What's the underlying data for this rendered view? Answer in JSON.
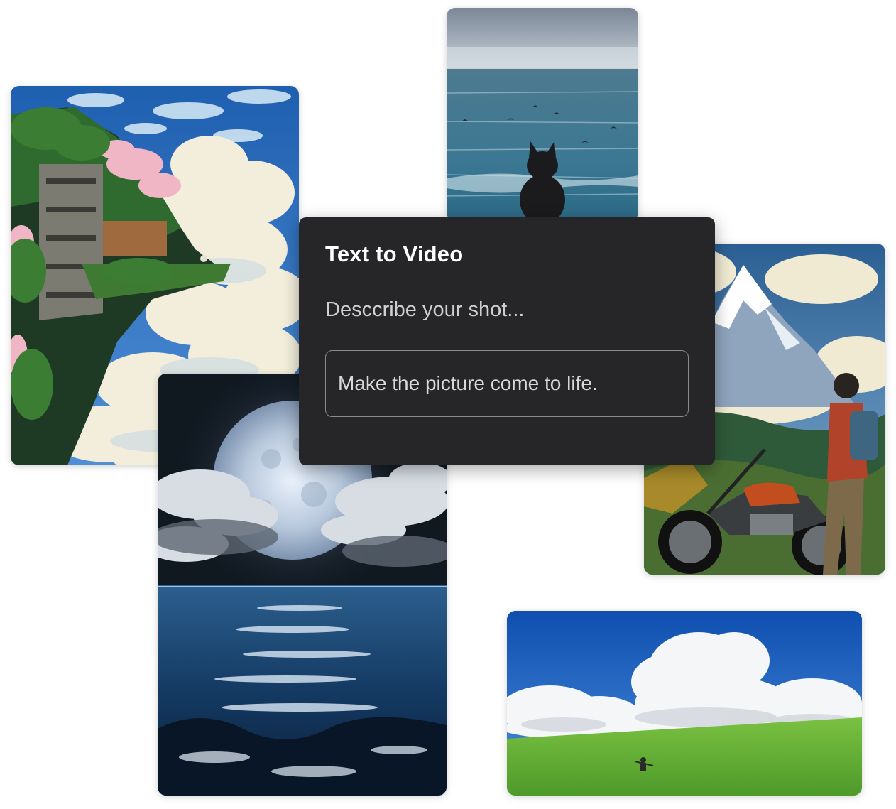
{
  "panel": {
    "title": "Text to Video",
    "subtitle": "Desccribe your shot...",
    "prompt_value": "Make the picture come to life."
  },
  "cards": [
    {
      "name": "floating-island-image"
    },
    {
      "name": "cat-by-sea-image"
    },
    {
      "name": "moonlit-ocean-image"
    },
    {
      "name": "motorcycle-mountain-image"
    },
    {
      "name": "cloud-field-image"
    }
  ]
}
